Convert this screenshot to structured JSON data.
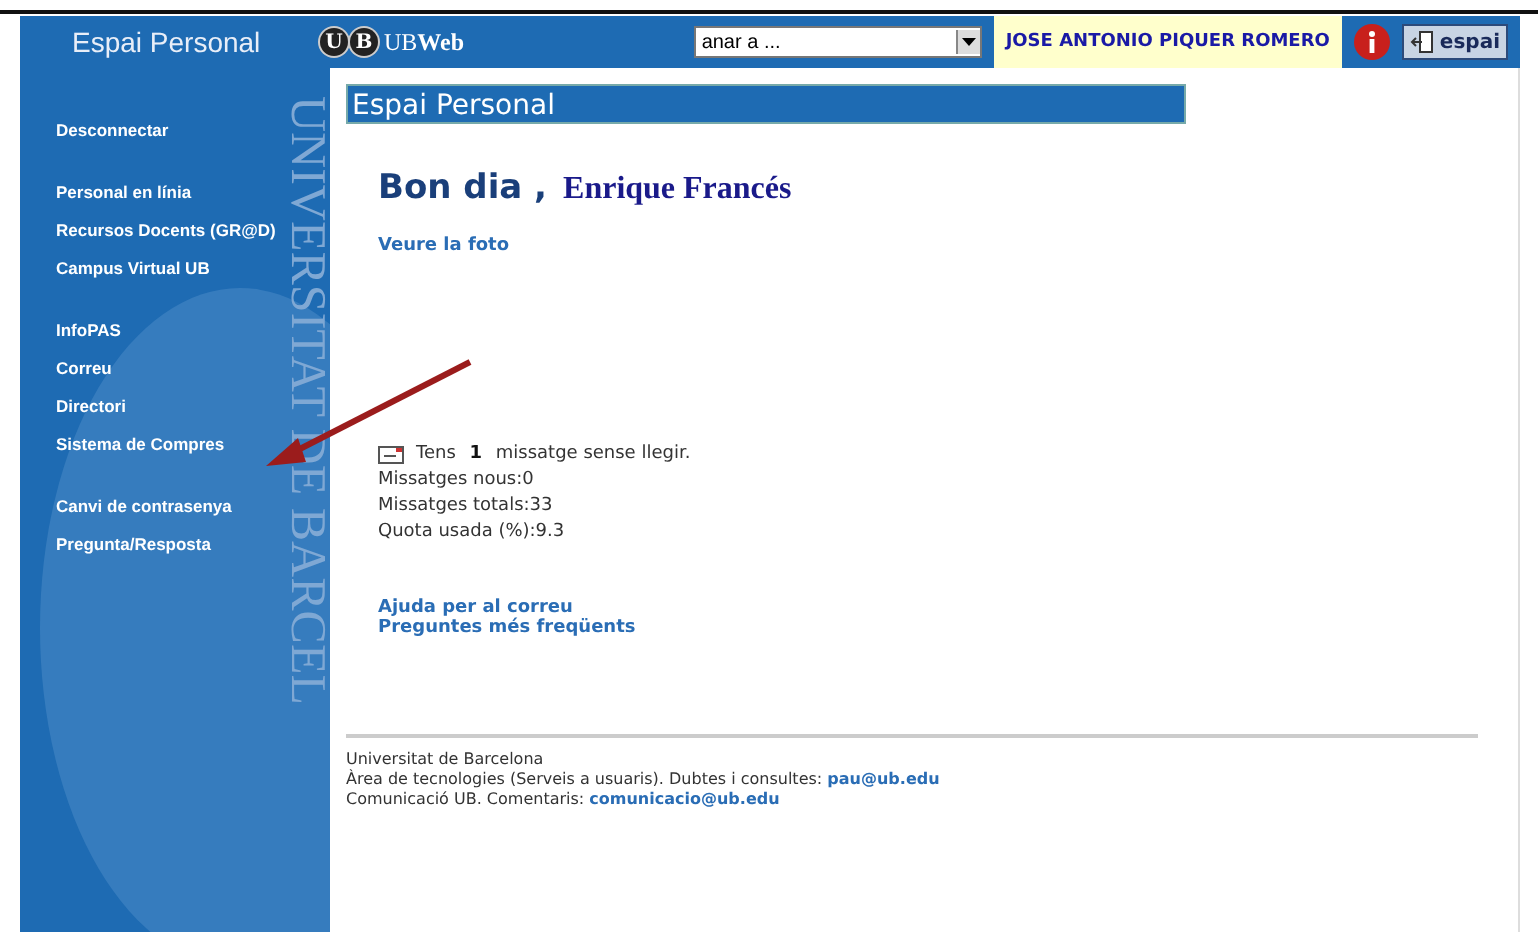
{
  "header": {
    "title": "Espai Personal",
    "logo_marks": [
      "U",
      "B"
    ],
    "logo_text": "UB**Web**",
    "goto_select": "anar a ...",
    "user_name": "JOSE ANTONIO PIQUER ROMERO",
    "exit_button": "espai"
  },
  "sidebar": {
    "watermark": "UNIVERSITAT DE BARCEL",
    "groups": [
      [
        "Desconnectar"
      ],
      [
        "Personal en línia",
        "Recursos Docents (GR@D)",
        "Campus Virtual UB"
      ],
      [
        "InfoPAS",
        "Correu",
        "Directori",
        "Sistema de Compres"
      ],
      [
        "Canvi de contrasenya",
        "Pregunta/Resposta"
      ]
    ]
  },
  "content": {
    "title": "Espai Personal",
    "greeting": "Bon dia ,",
    "user": "Enrique Francés",
    "photo_link": "Veure la foto",
    "mail": {
      "prefix": "Tens",
      "count": "1",
      "suffix": "missatge sense llegir.",
      "stats": [
        "Missatges nous:0",
        "Missatges totals:33",
        "Quota usada (%):9.3"
      ]
    },
    "links": [
      "Ajuda per al correu",
      "Preguntes més freqüents"
    ],
    "footer": [
      {
        "text": "Universitat de Barcelona"
      },
      {
        "text": "Àrea de tecnologies (Serveis a usuaris). Dubtes i consultes:",
        "link": "pau@ub.edu"
      },
      {
        "text": "Comunicació UB. Comentaris:",
        "link": "comunicacio@ub.edu"
      }
    ]
  },
  "annotation": {
    "kind": "arrow",
    "color": "#9b1c1c"
  }
}
